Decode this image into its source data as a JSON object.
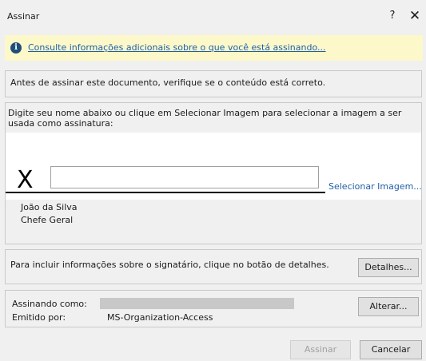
{
  "window": {
    "title": "Assinar",
    "help": "?",
    "close": "✕"
  },
  "infobar": {
    "icon": "i",
    "link": "Consulte informações adicionais sobre o que você está assinando..."
  },
  "warning": "Antes de assinar este documento, verifique se o conteúdo está correto.",
  "signature": {
    "instructions": "Digite seu nome abaixo ou clique em Selecionar Imagem para selecionar a imagem a ser usada como assinatura:",
    "x_mark": "X",
    "input_value": "",
    "select_image": "Selecionar Imagem...",
    "signer_name": "João da Silva",
    "signer_title": "Chefe Geral"
  },
  "details": {
    "text": "Para incluir informações sobre o signatário, clique no botão de detalhes.",
    "button": "Detalhes..."
  },
  "certificate": {
    "signing_as_label": "Assinando como:",
    "issued_by_label": "Emitido por:",
    "issued_by_value": "MS-Organization-Access",
    "change_button": "Alterar..."
  },
  "footer": {
    "sign_button": "Assinar",
    "cancel_button": "Cancelar"
  },
  "colors": {
    "infobar_bg": "#fcf8c9",
    "link": "#1f5fa8",
    "dialog_bg": "#f0f0f0"
  }
}
